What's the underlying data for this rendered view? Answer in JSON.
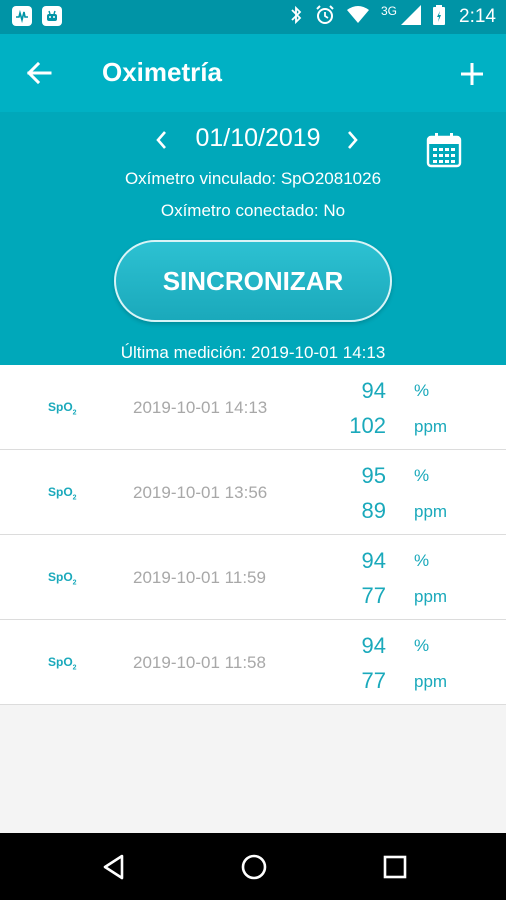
{
  "status_bar": {
    "network": "3G",
    "time": "2:14",
    "left_icons": [
      "activity-app-icon",
      "android-app-icon"
    ],
    "right_icons": [
      "bluetooth-icon",
      "alarm-icon",
      "wifi-icon",
      "signal-icon",
      "battery-icon"
    ]
  },
  "toolbar": {
    "title": "Oximetría",
    "back_icon": "arrow-left-icon",
    "add_icon": "plus-icon"
  },
  "header": {
    "date": "01/10/2019",
    "linked": "Oxímetro vinculado: SpO2081026",
    "connected": "Oxímetro conectado: No",
    "sync_label": "SINCRONIZAR",
    "last_measurement": "Última medición: 2019-10-01 14:13"
  },
  "measurements": [
    {
      "label": "SpO",
      "sub": "2",
      "datetime": "2019-10-01 14:13",
      "spo2": "94",
      "spo2_unit": "%",
      "pulse": "102",
      "pulse_unit": "ppm"
    },
    {
      "label": "SpO",
      "sub": "2",
      "datetime": "2019-10-01 13:56",
      "spo2": "95",
      "spo2_unit": "%",
      "pulse": "89",
      "pulse_unit": "ppm"
    },
    {
      "label": "SpO",
      "sub": "2",
      "datetime": "2019-10-01 11:59",
      "spo2": "94",
      "spo2_unit": "%",
      "pulse": "77",
      "pulse_unit": "ppm"
    },
    {
      "label": "SpO",
      "sub": "2",
      "datetime": "2019-10-01 11:58",
      "spo2": "94",
      "spo2_unit": "%",
      "pulse": "77",
      "pulse_unit": "ppm"
    }
  ],
  "colors": {
    "toolbar": "#00b1c4",
    "panel": "#00a8ba",
    "accent": "#1aa9bb",
    "muted_text": "#a8a8a8"
  }
}
